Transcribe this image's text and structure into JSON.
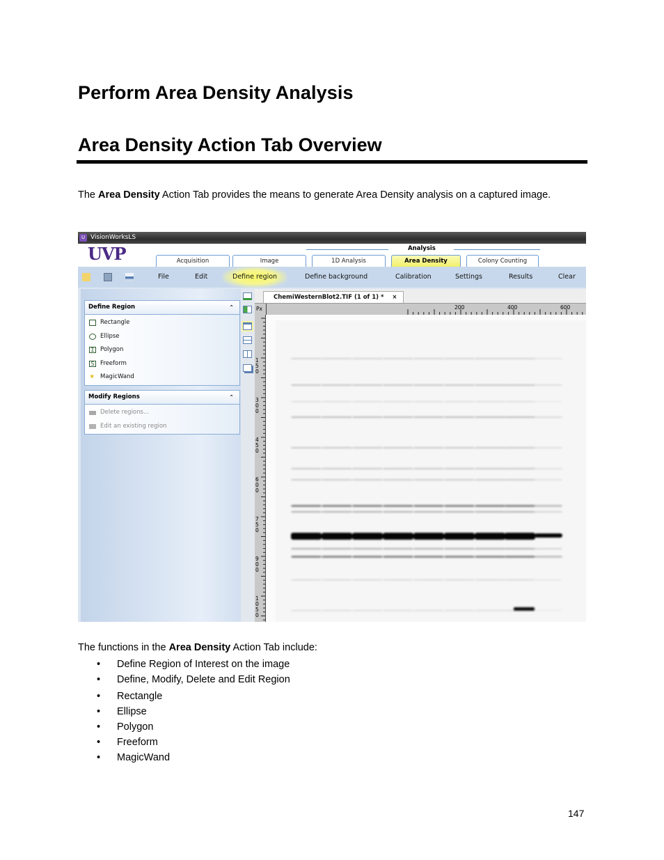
{
  "document": {
    "heading1": "Perform Area Density Analysis",
    "heading2": "Area Density Action Tab Overview",
    "intro": {
      "before": "The ",
      "bold": "Area Density",
      "after": " Action Tab provides the means to generate Area Density analysis on a captured image."
    },
    "lead": {
      "before": "The functions in the ",
      "bold": "Area Density",
      "after": " Action Tab include:"
    },
    "functions": [
      "Define Region of Interest on the image",
      "Define, Modify, Delete and Edit Region",
      "Rectangle",
      "Ellipse",
      "Polygon",
      "Freeform",
      "MagicWand"
    ],
    "page_number": "147"
  },
  "app": {
    "window_title": "VisionWorksLS",
    "logo": "UVP",
    "ribbon_group": "Analysis",
    "tabs": [
      {
        "label": "Acquisition",
        "active": false
      },
      {
        "label": "Image",
        "active": false
      },
      {
        "label": "1D Analysis",
        "active": false
      },
      {
        "label": "Area Density",
        "active": true
      },
      {
        "label": "Colony Counting",
        "active": false
      }
    ],
    "toolbar_icons": [
      "open-folder-icon",
      "save-icon",
      "print-icon"
    ],
    "toolbar": [
      "File",
      "Edit",
      "Define region",
      "Define background",
      "Calibration",
      "Settings",
      "Results",
      "Clear"
    ],
    "toolbar_highlight": "Define region",
    "define_region_panel": {
      "title": "Define Region",
      "items": [
        {
          "label": "Rectangle",
          "icon": "rectangle-icon"
        },
        {
          "label": "Ellipse",
          "icon": "ellipse-icon"
        },
        {
          "label": "Polygon",
          "icon": "polygon-icon"
        },
        {
          "label": "Freeform",
          "icon": "freeform-icon"
        },
        {
          "label": "MagicWand",
          "icon": "magic-wand-icon"
        }
      ]
    },
    "modify_regions_panel": {
      "title": "Modify Regions",
      "items": [
        {
          "label": "Delete regions...",
          "icon": "delete-regions-icon",
          "disabled": true
        },
        {
          "label": "Edit an existing region",
          "icon": "edit-region-icon",
          "disabled": true
        }
      ]
    },
    "document_tab": "ChemiWesternBlot2.TIF (1 of 1) *",
    "close_glyph": "×",
    "ruler_unit": "Px",
    "hruler_labels": [
      "200",
      "400",
      "600"
    ],
    "vruler_labels": [
      "150",
      "300",
      "450",
      "600",
      "750",
      "900",
      "1050"
    ]
  }
}
